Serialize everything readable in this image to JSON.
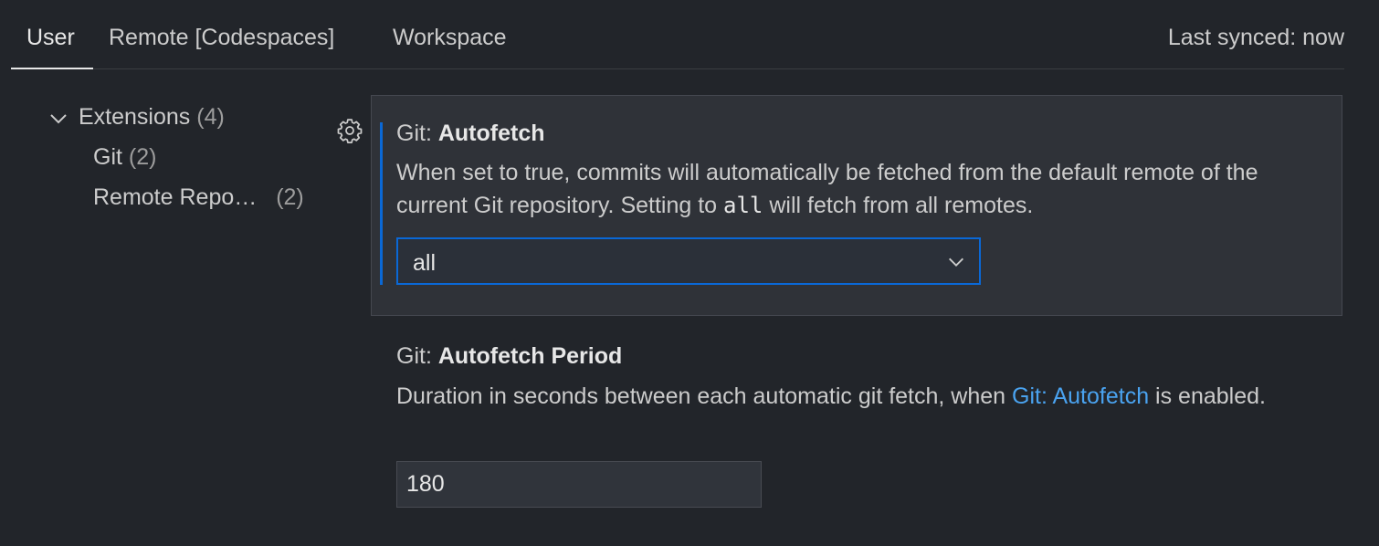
{
  "tabs": [
    {
      "label": "User",
      "active": true
    },
    {
      "label": "Remote [Codespaces]",
      "active": false
    },
    {
      "label": "Workspace",
      "active": false
    }
  ],
  "sync_status": "Last synced: now",
  "toc": {
    "group": {
      "label": "Extensions",
      "count": "(4)",
      "expanded": true
    },
    "items": [
      {
        "label": "Git",
        "count": "(2)"
      },
      {
        "label": "Remote Repo…",
        "count": "(2)"
      }
    ]
  },
  "settings": {
    "autofetch": {
      "category": "Git: ",
      "name": "Autofetch",
      "desc_part1": "When set to true, commits will automatically be fetched from the default remote of the current Git repository. Setting to ",
      "desc_code": "all",
      "desc_part2": " will fetch from all remotes.",
      "value": "all",
      "options": [
        "all"
      ]
    },
    "autofetch_period": {
      "category": "Git: ",
      "name": "Autofetch Period",
      "desc_part1": "Duration in seconds between each automatic git fetch, when ",
      "desc_link": "Git: Autofetch",
      "desc_part2": " is enabled.",
      "value": "180"
    }
  },
  "colors": {
    "background": "#22252a",
    "focused_panel": "#2f3238",
    "accent": "#0a68d6",
    "link": "#4aa3f0"
  },
  "icons": {
    "toc_chevron": "chevron-down-icon",
    "settings_gear": "gear-icon",
    "dropdown_chevron": "chevron-down-icon"
  }
}
